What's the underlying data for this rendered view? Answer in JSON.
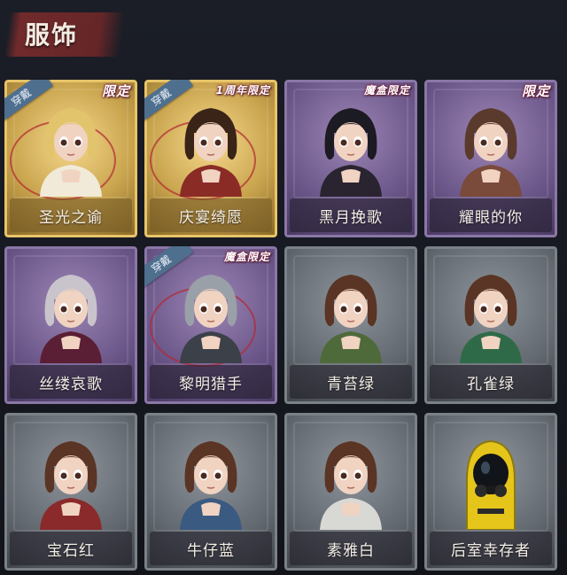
{
  "header": {
    "title": "服饰"
  },
  "labels": {
    "worn": "穿戴"
  },
  "items": [
    {
      "name": "圣光之谕",
      "rarity": "gold",
      "tag": "限定",
      "worn": true,
      "art": "blonde-girl-icon",
      "hair": "#e2c46c",
      "outfit": "#f1ead8"
    },
    {
      "name": "庆宴绮愿",
      "rarity": "gold",
      "tag": "1周年限定",
      "worn": true,
      "art": "cake-boy-icon",
      "hair": "#3a2418",
      "outfit": "#8a2b26"
    },
    {
      "name": "黑月挽歌",
      "rarity": "purple",
      "tag": "魔盒限定",
      "worn": false,
      "art": "dark-lady-icon",
      "hair": "#1c1a22",
      "outfit": "#2a2430"
    },
    {
      "name": "耀眼的你",
      "rarity": "purple",
      "tag": "限定",
      "worn": false,
      "art": "cowgirl-icon",
      "hair": "#5a3a2c",
      "outfit": "#7a4a3a"
    },
    {
      "name": "丝缕哀歌",
      "rarity": "purple",
      "tag": "",
      "worn": false,
      "art": "lace-girl-icon",
      "hair": "#c9c3cc",
      "outfit": "#5a1f34"
    },
    {
      "name": "黎明猎手",
      "rarity": "purple",
      "tag": "魔盒限定",
      "worn": true,
      "art": "silver-hunter-icon",
      "hair": "#9aa0a8",
      "outfit": "#3c4048"
    },
    {
      "name": "青苔绿",
      "rarity": "grey",
      "tag": "",
      "worn": false,
      "art": "brown-girl-icon",
      "hair": "#5a3424",
      "outfit": "#4f6a3a"
    },
    {
      "name": "孔雀绿",
      "rarity": "grey",
      "tag": "",
      "worn": false,
      "art": "brown-girl-icon",
      "hair": "#5a3424",
      "outfit": "#2f6a48"
    },
    {
      "name": "宝石红",
      "rarity": "grey",
      "tag": "",
      "worn": false,
      "art": "brown-girl-icon",
      "hair": "#5a3424",
      "outfit": "#8a2a2a"
    },
    {
      "name": "牛仔蓝",
      "rarity": "grey",
      "tag": "",
      "worn": false,
      "art": "brown-girl-icon",
      "hair": "#5a3424",
      "outfit": "#3b5a82"
    },
    {
      "name": "素雅白",
      "rarity": "grey",
      "tag": "",
      "worn": false,
      "art": "brown-girl-icon",
      "hair": "#5a3424",
      "outfit": "#d8d8d4"
    },
    {
      "name": "后室幸存者",
      "rarity": "grey",
      "tag": "",
      "worn": false,
      "art": "hazmat-gasmask-icon",
      "hair": "#e6c51a",
      "outfit": "#e6c51a"
    }
  ]
}
